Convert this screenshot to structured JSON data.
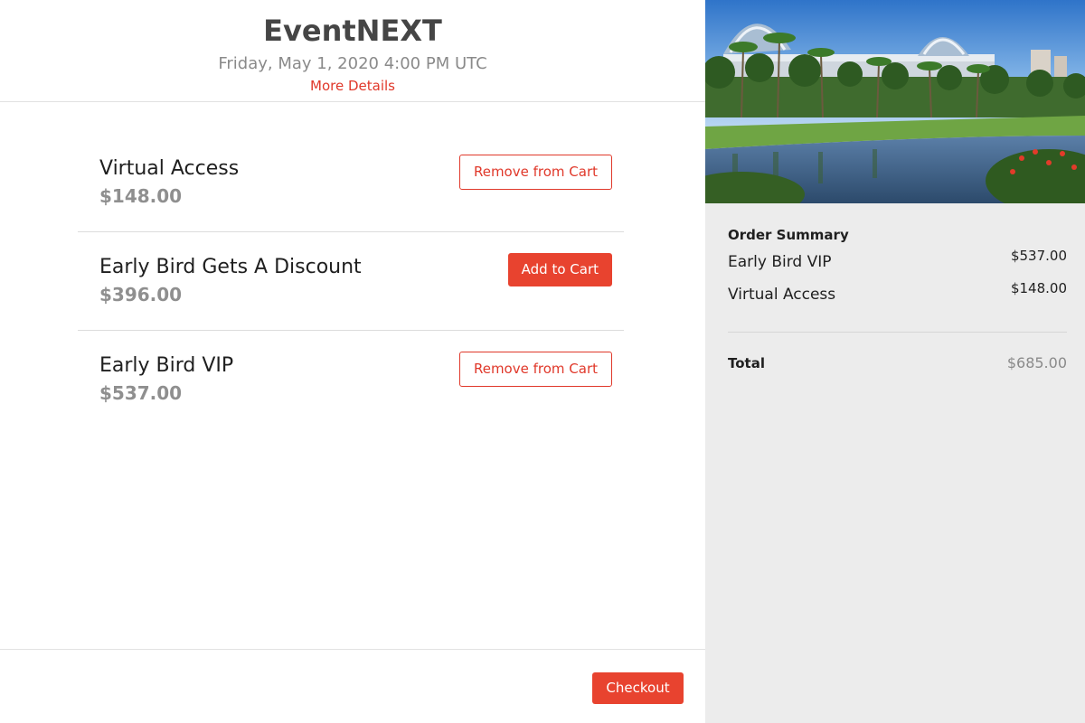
{
  "event": {
    "title": "EventNEXT",
    "date": "Friday, May 1, 2020 4:00 PM UTC",
    "details_link": "More Details"
  },
  "tickets": [
    {
      "name": "Virtual Access",
      "price": "$148.00",
      "action": "Remove from Cart",
      "in_cart": true
    },
    {
      "name": "Early Bird Gets A Discount",
      "price": "$396.00",
      "action": "Add to Cart",
      "in_cart": false
    },
    {
      "name": "Early Bird VIP",
      "price": "$537.00",
      "action": "Remove from Cart",
      "in_cart": true
    }
  ],
  "footer": {
    "checkout_label": "Checkout"
  },
  "summary": {
    "title": "Order Summary",
    "items": [
      {
        "name": "Early Bird VIP",
        "price": "$537.00"
      },
      {
        "name": "Virtual Access",
        "price": "$148.00"
      }
    ],
    "total_label": "Total",
    "total_value": "$685.00"
  },
  "colors": {
    "accent": "#e8432f",
    "link": "#e0382a",
    "sidebar_bg": "#ececec",
    "price_gray": "#8f8f8f"
  }
}
